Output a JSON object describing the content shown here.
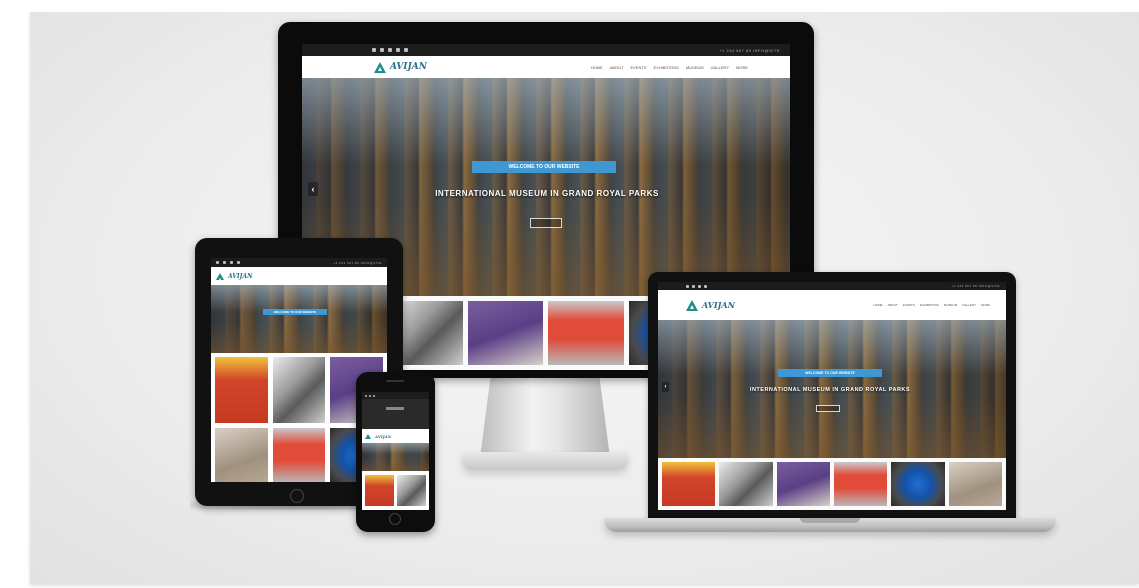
{
  "scene": {
    "description_devices": [
      "monitor",
      "tablet",
      "laptop",
      "phone"
    ]
  },
  "site": {
    "logo_text": "AVIJAN",
    "menu": [
      "HOME",
      "ABOUT",
      "EVENTS",
      "EXHIBITIONS",
      "MUSEUM",
      "GALLERY",
      "MORE"
    ],
    "banner_text": "WELCOME TO OUR WEBSITE",
    "hero_title": "INTERNATIONAL MUSEUM IN GRAND ROYAL PARKS",
    "topbar_contact": "+1 234 567 89   INFO@SITE"
  },
  "icons": {
    "logo": "triangle-logo-icon",
    "prev": "chevron-left-icon",
    "next": "chevron-right-icon",
    "home_button": "home-button-icon"
  },
  "colors": {
    "banner": "#3e98d4",
    "logo": "#1f8f86",
    "device_frame": "#0b0b0b"
  }
}
